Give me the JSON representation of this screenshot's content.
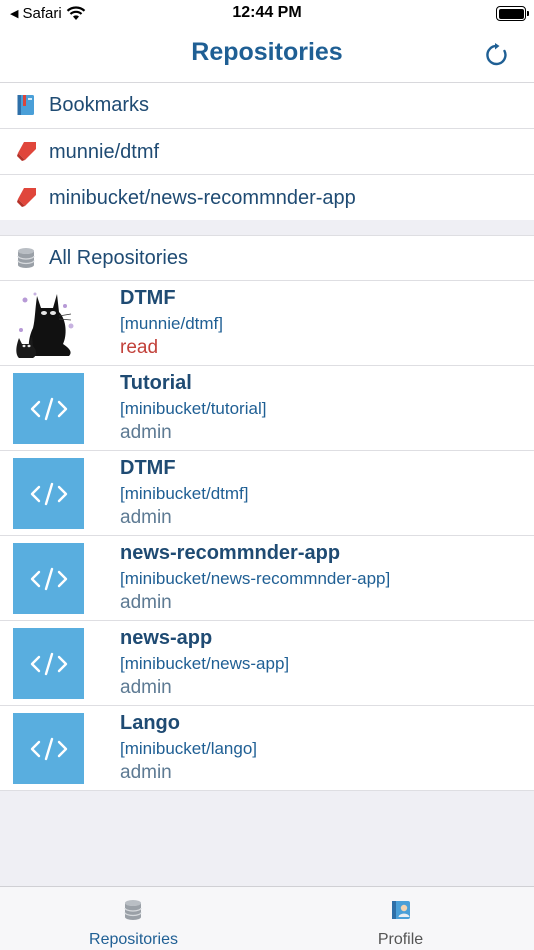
{
  "status": {
    "carrier": "Safari",
    "time": "12:44 PM"
  },
  "nav": {
    "title": "Repositories"
  },
  "bookmarks": {
    "header": "Bookmarks",
    "items": [
      {
        "label": "munnie/dtmf"
      },
      {
        "label": "minibucket/news-recommnder-app"
      }
    ]
  },
  "all_repos_header": "All Repositories",
  "repositories": [
    {
      "name": "DTMF",
      "path": "[munnie/dtmf]",
      "role": "read"
    },
    {
      "name": "Tutorial",
      "path": "[minibucket/tutorial]",
      "role": "admin"
    },
    {
      "name": "DTMF",
      "path": "[minibucket/dtmf]",
      "role": "admin"
    },
    {
      "name": "news-recommnder-app",
      "path": "[minibucket/news-recommnder-app]",
      "role": "admin"
    },
    {
      "name": "news-app",
      "path": "[minibucket/news-app]",
      "role": "admin"
    },
    {
      "name": "Lango",
      "path": "[minibucket/lango]",
      "role": "admin"
    }
  ],
  "tabs": [
    {
      "label": "Repositories"
    },
    {
      "label": "Profile"
    }
  ],
  "colors": {
    "accent": "#1f5f94",
    "thumb": "#59aedf",
    "read": "#c2413a"
  }
}
